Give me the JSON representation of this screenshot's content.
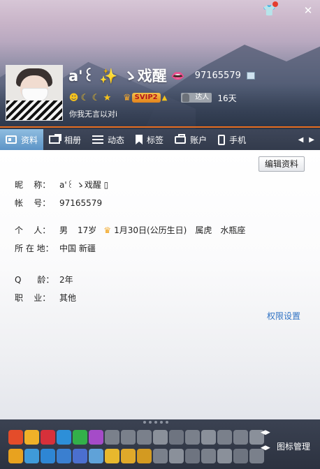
{
  "header": {
    "nickname": "a'꒰ ✨ ゝ戏醒",
    "account_number": "97165579",
    "signature": "你我无言以对i",
    "days_text": "16天",
    "talent_label": "达人",
    "vip_label": "SVIP2",
    "skin_icon": "shirt-icon",
    "close_label": "✕"
  },
  "tabs": [
    {
      "label": "资料",
      "icon": "profile-card-icon",
      "active": true
    },
    {
      "label": "相册",
      "icon": "album-icon"
    },
    {
      "label": "动态",
      "icon": "feed-list-icon"
    },
    {
      "label": "标签",
      "icon": "bookmark-icon"
    },
    {
      "label": "账户",
      "icon": "wallet-icon"
    },
    {
      "label": "手机",
      "icon": "phone-icon"
    }
  ],
  "content": {
    "edit_button": "编辑资料",
    "fields": {
      "nickname": {
        "label": "昵    称：",
        "value": "a'꒰ ゝ戏醒 ▯"
      },
      "account": {
        "label": "帐    号：",
        "value": "97165579"
      },
      "personal": {
        "label": "个    人：",
        "gender": "男",
        "age": "17岁",
        "birthday": "1月30日(公历生日)",
        "zodiac": "属虎",
        "constellation": "水瓶座"
      },
      "location": {
        "label": "所 在 地：",
        "value": "中国 新疆"
      },
      "qage": {
        "label": "Q      龄：",
        "value": "2年"
      },
      "job": {
        "label": "职    业：",
        "value": "其他"
      }
    },
    "permission_link": "权限设置"
  },
  "bottom_bar": {
    "icon_manage_label": "图标管理"
  },
  "colors": {
    "accent_orange": "#e66c1f",
    "tab_active": "#6aa1d0",
    "link_blue": "#2f72c3"
  }
}
